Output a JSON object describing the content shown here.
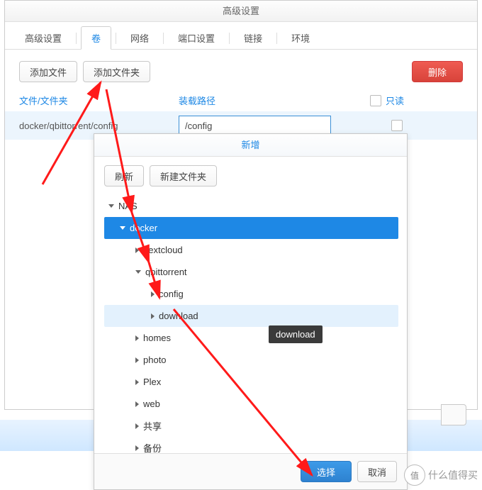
{
  "modal": {
    "title": "高级设置",
    "tabs": [
      "高级设置",
      "卷",
      "网络",
      "端口设置",
      "链接",
      "环境"
    ],
    "active_tab_index": 1,
    "buttons": {
      "add_file": "添加文件",
      "add_folder": "添加文件夹",
      "delete": "删除"
    },
    "columns": {
      "path": "文件/文件夹",
      "mount": "装载路径",
      "readonly": "只读"
    },
    "row": {
      "host_path": "docker/qbittorrent/config",
      "mount_path": "/config",
      "readonly": false
    }
  },
  "picker": {
    "title": "新增",
    "buttons": {
      "refresh": "刷新",
      "new_folder": "新建文件夹",
      "select": "选择",
      "cancel": "取消"
    },
    "tree": {
      "root": "NAS",
      "nodes": [
        {
          "name": "docker",
          "depth": 1,
          "expanded": true,
          "selected": true
        },
        {
          "name": "nextcloud",
          "depth": 2,
          "expanded": false
        },
        {
          "name": "qbittorrent",
          "depth": 2,
          "expanded": true
        },
        {
          "name": "config",
          "depth": 3,
          "expanded": false
        },
        {
          "name": "download",
          "depth": 3,
          "expanded": false,
          "highlight": true
        },
        {
          "name": "homes",
          "depth": 2,
          "expanded": false,
          "tooltip": "download"
        },
        {
          "name": "photo",
          "depth": 2,
          "expanded": false
        },
        {
          "name": "Plex",
          "depth": 2,
          "expanded": false
        },
        {
          "name": "web",
          "depth": 2,
          "expanded": false
        },
        {
          "name": "共享",
          "depth": 2,
          "expanded": false
        },
        {
          "name": "备份",
          "depth": 2,
          "expanded": false
        }
      ]
    }
  },
  "watermark": {
    "badge": "值",
    "text": "什么值得买"
  }
}
